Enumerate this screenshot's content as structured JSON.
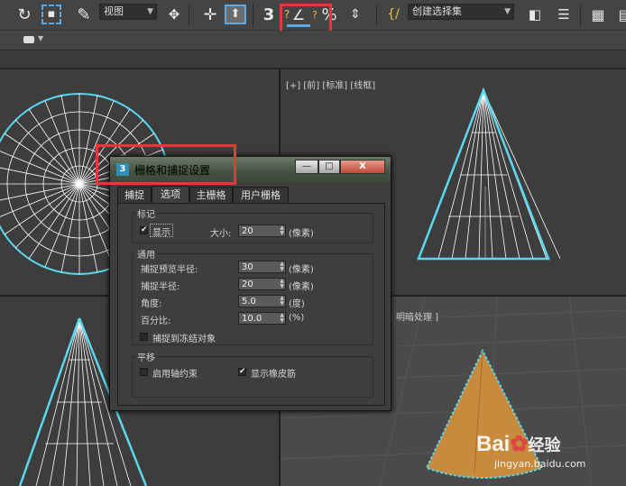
{
  "toolbar": {
    "view_combo": "视图",
    "selection_set_combo": "创建选择集",
    "snap_number": "3",
    "angle_snap_number": "3",
    "percent_snap": "%"
  },
  "viewport_top_right": {
    "label": "[+] [前] [标准] [线框]"
  },
  "viewport_bottom_right": {
    "label": "明暗处理 ]"
  },
  "dialog": {
    "title": "栅格和捕捉设置",
    "app_icon": "3",
    "minimize": "—",
    "maximize": "□",
    "close": "X",
    "tabs": [
      {
        "label": "捕捉"
      },
      {
        "label": "选项"
      },
      {
        "label": "主栅格"
      },
      {
        "label": "用户栅格"
      }
    ],
    "marker_group": {
      "title": "标记",
      "display_label": "显示",
      "display_checked": "✔",
      "size_label": "大小:",
      "size_value": "20",
      "size_unit": "(像素)"
    },
    "general_group": {
      "title": "通用",
      "snap_preview_radius_label": "捕捉预览半径:",
      "snap_preview_radius_value": "30",
      "snap_preview_radius_unit": "(像素)",
      "snap_radius_label": "捕捉半径:",
      "snap_radius_value": "20",
      "snap_radius_unit": "(像素)",
      "angle_label": "角度:",
      "angle_value": "5.0",
      "angle_unit": "(度)",
      "percent_label": "百分比:",
      "percent_value": "10.0",
      "percent_unit": "(%)",
      "snap_frozen_label": "捕捉到冻结对象"
    },
    "translation_group": {
      "title": "平移",
      "axis_constraint_label": "启用轴约束",
      "rubber_band_label": "显示橡皮筋",
      "rubber_band_checked": "✔"
    }
  },
  "watermark": {
    "brand": "Bai",
    "suffix": "经验",
    "url": "jingyan.baidu.com"
  }
}
